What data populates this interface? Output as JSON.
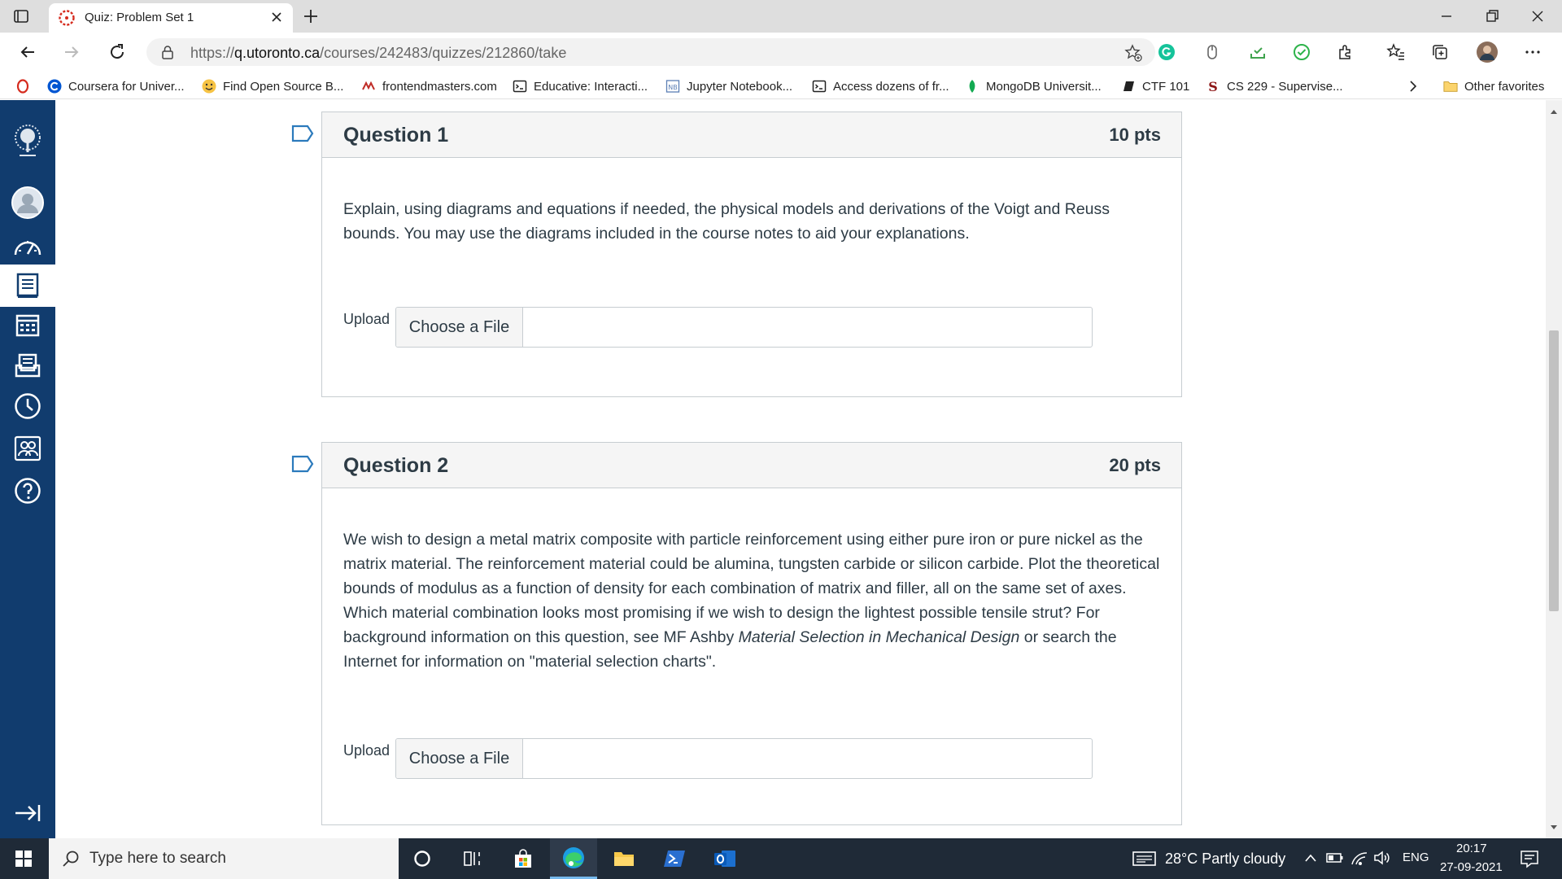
{
  "tab": {
    "title": "Quiz: Problem Set 1"
  },
  "address": {
    "url_prefix": "https://",
    "url_domain": "q.utoronto.ca",
    "url_path": "/courses/242483/quizzes/212860/take"
  },
  "favorites": [
    {
      "label": "Coursera for Univer...",
      "icon": "coursera-icon"
    },
    {
      "label": "Find Open Source B...",
      "icon": "emoji-icon"
    },
    {
      "label": "frontendmasters.com",
      "icon": "frontendmasters-icon"
    },
    {
      "label": "Educative: Interacti...",
      "icon": "terminal-icon"
    },
    {
      "label": "Jupyter Notebook...",
      "icon": "notebook-icon"
    },
    {
      "label": "Access dozens of fr...",
      "icon": "terminal-icon"
    },
    {
      "label": "MongoDB Universit...",
      "icon": "leaf-icon"
    },
    {
      "label": "CTF 101",
      "icon": "book-icon"
    },
    {
      "label": "CS 229 - Supervise...",
      "icon": "stanford-icon"
    }
  ],
  "favorites_other": "Other favorites",
  "questions": [
    {
      "title": "Question 1",
      "points": "10 pts",
      "text": "Explain, using diagrams and equations if needed, the physical models and derivations of the Voigt and Reuss bounds. You may use the diagrams included in the course notes to aid your explanations.",
      "upload_label": "Upload",
      "button": "Choose a File"
    },
    {
      "title": "Question 2",
      "points": "20 pts",
      "text_part1": "We wish to design a metal matrix composite with particle reinforcement using either pure iron or pure nickel as the matrix material. The reinforcement material could be alumina, tungsten carbide or silicon carbide. Plot the theoretical bounds of modulus as a function of density for each combination of matrix and filler, all on the same set of axes. Which material combination looks most promising if we wish to design the lightest possible tensile strut? For background information on this question, see MF Ashby ",
      "text_italic": "Material Selection in Mechanical Design",
      "text_part2": " or search the Internet for information on \"material selection charts\".",
      "upload_label": "Upload",
      "button": "Choose a File"
    }
  ],
  "taskbar": {
    "search_placeholder": "Type here to search",
    "weather": "28°C  Partly cloudy",
    "lang": "ENG",
    "time": "20:17",
    "date": "27-09-2021"
  },
  "colors": {
    "canvas_nav": "#113c6e",
    "brand_red": "#d52b1e"
  }
}
